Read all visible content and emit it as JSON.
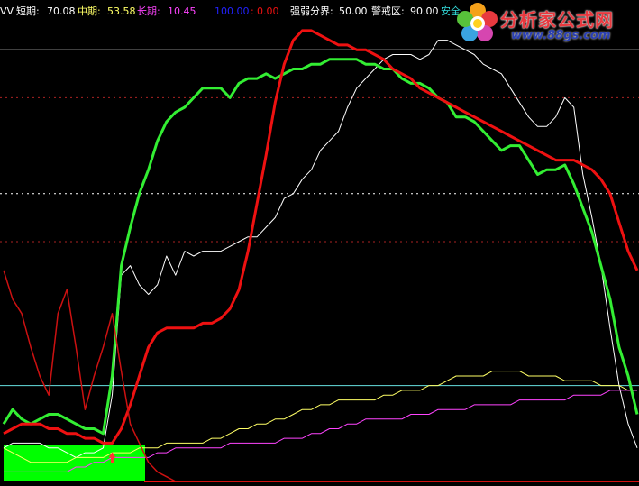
{
  "header": {
    "indicator_prefix": "VV",
    "short_label": "短期:",
    "short_value": "70.08",
    "mid_label": "中期:",
    "mid_value": "53.58",
    "long_label": "长期:",
    "long_value": "10.45",
    "scale_top": "100.00",
    "scale_sep": ":",
    "scale_bottom": "0.00",
    "strength_label": "强弱分界:",
    "strength_value": "50.00",
    "warning_label": "警戒区:",
    "warning_value": "90.00",
    "safe_label": "安全"
  },
  "logo": {
    "title": "分析家公式网",
    "url": "www.88gs.com"
  },
  "colors": {
    "short": "#ffffff",
    "mid": "#ffff66",
    "long": "#ff44ff",
    "green_line": "#33ee33",
    "red_line": "#ee1111",
    "dark_red_line": "#cc1111",
    "cyan_level": "#66e0e0",
    "white_level": "#ffffff",
    "dotted_red": "#aa2222",
    "green_box": "#00ff00",
    "header_blue": "#2222ff"
  },
  "chart_data": {
    "type": "line",
    "ylim": [
      0,
      100
    ],
    "reference_levels": [
      {
        "value": 90,
        "style": "solid",
        "color": "#ffffff"
      },
      {
        "value": 80,
        "style": "dotted",
        "color": "#aa2222"
      },
      {
        "value": 60,
        "style": "dotted",
        "color": "#ffffff"
      },
      {
        "value": 50,
        "style": "dotted",
        "color": "#aa2222"
      },
      {
        "value": 20,
        "style": "solid",
        "color": "#66e0e0"
      }
    ],
    "x": [
      0,
      1,
      2,
      3,
      4,
      5,
      6,
      7,
      8,
      9,
      10,
      11,
      12,
      13,
      14,
      15,
      16,
      17,
      18,
      19,
      20,
      21,
      22,
      23,
      24,
      25,
      26,
      27,
      28,
      29,
      30,
      31,
      32,
      33,
      34,
      35,
      36,
      37,
      38,
      39,
      40,
      41,
      42,
      43,
      44,
      45,
      46,
      47,
      48,
      49,
      50,
      51,
      52,
      53,
      54,
      55,
      56,
      57,
      58,
      59,
      60,
      61,
      62,
      63,
      64,
      65,
      66,
      67,
      68,
      69,
      70
    ],
    "series": [
      {
        "values": [
          7,
          8,
          8,
          8,
          8,
          7,
          7,
          6,
          5,
          6,
          6,
          7,
          18,
          43,
          45,
          41,
          39,
          41,
          47,
          43,
          48,
          47,
          48,
          48,
          48,
          49,
          50,
          51,
          51,
          53,
          55,
          59,
          60,
          63,
          65,
          69,
          71,
          73,
          78,
          82,
          84,
          86,
          88,
          89,
          89,
          89,
          88,
          89,
          92,
          92,
          91,
          90,
          89,
          87,
          86,
          85,
          82,
          79,
          76,
          74,
          74,
          76,
          80,
          78,
          64,
          55,
          45,
          32,
          20,
          12,
          7
        ]
      },
      {
        "values": [
          7,
          6,
          5,
          4,
          4,
          4,
          4,
          4,
          5,
          5,
          5,
          5,
          6,
          6,
          6,
          7,
          7,
          7,
          8,
          8,
          8,
          8,
          8,
          9,
          9,
          10,
          11,
          11,
          12,
          12,
          13,
          13,
          14,
          15,
          15,
          16,
          16,
          17,
          17,
          17,
          17,
          17,
          18,
          18,
          19,
          19,
          19,
          20,
          20,
          21,
          22,
          22,
          22,
          22,
          23,
          23,
          23,
          23,
          22,
          22,
          22,
          22,
          21,
          21,
          21,
          21,
          20,
          20,
          20,
          19,
          19
        ]
      },
      {
        "values": [
          2,
          2,
          2,
          2,
          2,
          2,
          2,
          2,
          3,
          3,
          4,
          4,
          5,
          5,
          5,
          5,
          5,
          6,
          6,
          7,
          7,
          7,
          7,
          7,
          7,
          8,
          8,
          8,
          8,
          8,
          8,
          9,
          9,
          9,
          10,
          10,
          11,
          11,
          12,
          12,
          13,
          13,
          13,
          13,
          13,
          14,
          14,
          14,
          15,
          15,
          15,
          15,
          16,
          16,
          16,
          16,
          16,
          17,
          17,
          17,
          17,
          17,
          17,
          18,
          18,
          18,
          18,
          19,
          19,
          19,
          19
        ]
      },
      {
        "values": [
          12,
          15,
          13,
          12,
          13,
          14,
          14,
          13,
          12,
          11,
          11,
          10,
          22,
          45,
          53,
          60,
          65,
          71,
          75,
          77,
          78,
          80,
          82,
          82,
          82,
          80,
          83,
          84,
          84,
          85,
          84,
          85,
          86,
          86,
          87,
          87,
          88,
          88,
          88,
          88,
          87,
          87,
          86,
          86,
          84,
          83,
          83,
          82,
          80,
          79,
          76,
          76,
          75,
          73,
          71,
          69,
          70,
          70,
          67,
          64,
          65,
          65,
          66,
          62,
          57,
          52,
          45,
          38,
          28,
          22,
          14
        ]
      },
      {
        "values": [
          10,
          11,
          12,
          12,
          12,
          11,
          11,
          10,
          10,
          9,
          9,
          8,
          8,
          11,
          16,
          22,
          28,
          31,
          32,
          32,
          32,
          32,
          33,
          33,
          34,
          36,
          40,
          48,
          58,
          68,
          79,
          87,
          92,
          94,
          94,
          93,
          92,
          91,
          91,
          90,
          90,
          89,
          88,
          86,
          85,
          84,
          82,
          81,
          80,
          79,
          78,
          77,
          76,
          75,
          74,
          73,
          72,
          71,
          70,
          69,
          68,
          67,
          67,
          67,
          66,
          65,
          63,
          60,
          54,
          48,
          44
        ]
      },
      {
        "values": [
          44,
          38,
          35,
          28,
          22,
          18,
          35,
          40,
          28,
          15,
          22,
          28,
          35,
          23,
          12,
          8,
          4,
          2,
          1,
          0,
          0,
          0,
          0,
          0,
          0,
          0,
          0,
          0,
          0,
          0,
          0,
          0,
          0,
          0,
          0,
          0,
          0,
          0,
          0,
          0,
          0,
          0,
          0,
          0,
          0,
          0,
          0,
          0,
          0,
          0,
          0,
          0,
          0,
          0,
          0,
          0,
          0,
          0,
          0,
          0,
          0,
          0,
          0,
          0,
          0,
          0,
          0,
          0,
          0,
          0,
          0
        ]
      }
    ],
    "markers": [
      {
        "x": 12,
        "y": 5,
        "shape": "up-arrow",
        "color": "#ff3333"
      }
    ]
  }
}
